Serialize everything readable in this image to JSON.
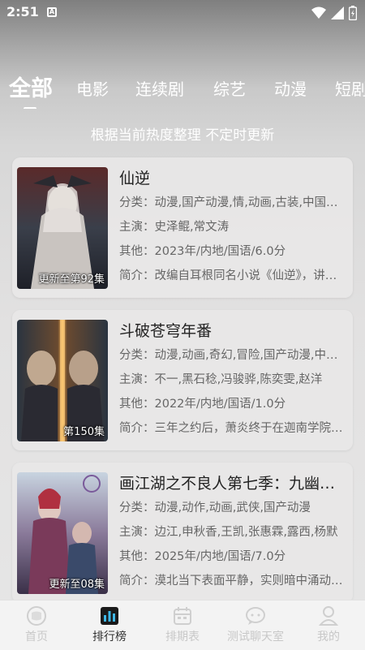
{
  "status": {
    "time": "2:51"
  },
  "tabs": [
    {
      "label": "全部",
      "active": true
    },
    {
      "label": "电影"
    },
    {
      "label": "连续剧"
    },
    {
      "label": "综艺"
    },
    {
      "label": "动漫"
    },
    {
      "label": "短剧"
    }
  ],
  "subtitle": "根据当前热度整理 不定时更新",
  "cards": [
    {
      "title": "仙逆",
      "badge": "更新至第92集",
      "category": "分类：动漫,国产动漫,情,动画,古装,中国动漫",
      "cast": "主演：史泽鲲,常文涛",
      "other": "其他：2023年/内地/国语/6.0分",
      "intro": "简介：改编自耳根同名小说《仙逆》，讲述乡村平凡少年王林"
    },
    {
      "title": "斗破苍穹年番",
      "badge": "第150集",
      "category": "分类：动漫,动画,奇幻,冒险,国产动漫,中国动漫",
      "cast": "主演：不一,黑石稔,冯骏骅,陈奕雯,赵洋",
      "other": "其他：2022年/内地/国语/1.0分",
      "intro": "简介：三年之约后，萧炎终于在迦南学院见到了萧薰儿"
    },
    {
      "title": "画江湖之不良人第七季：九幽玄天",
      "badge": "更新至08集",
      "category": "分类：动漫,动作,动画,武侠,国产动漫",
      "cast": "主演：边江,申秋香,王凯,张惠霖,露西,杨默",
      "other": "其他：2025年/内地/国语/7.0分",
      "intro": "简介：漠北当下表面平静，实则暗中涌动着危机"
    }
  ],
  "nav": [
    {
      "label": "首页",
      "icon": "home-icon"
    },
    {
      "label": "排行榜",
      "icon": "ranking-icon",
      "active": true
    },
    {
      "label": "排期表",
      "icon": "calendar-icon"
    },
    {
      "label": "测试聊天室",
      "icon": "chat-icon"
    },
    {
      "label": "我的",
      "icon": "profile-icon"
    }
  ],
  "colors": {
    "accent": "#3fb8e8",
    "text": "#222222",
    "muted": "#666666"
  }
}
